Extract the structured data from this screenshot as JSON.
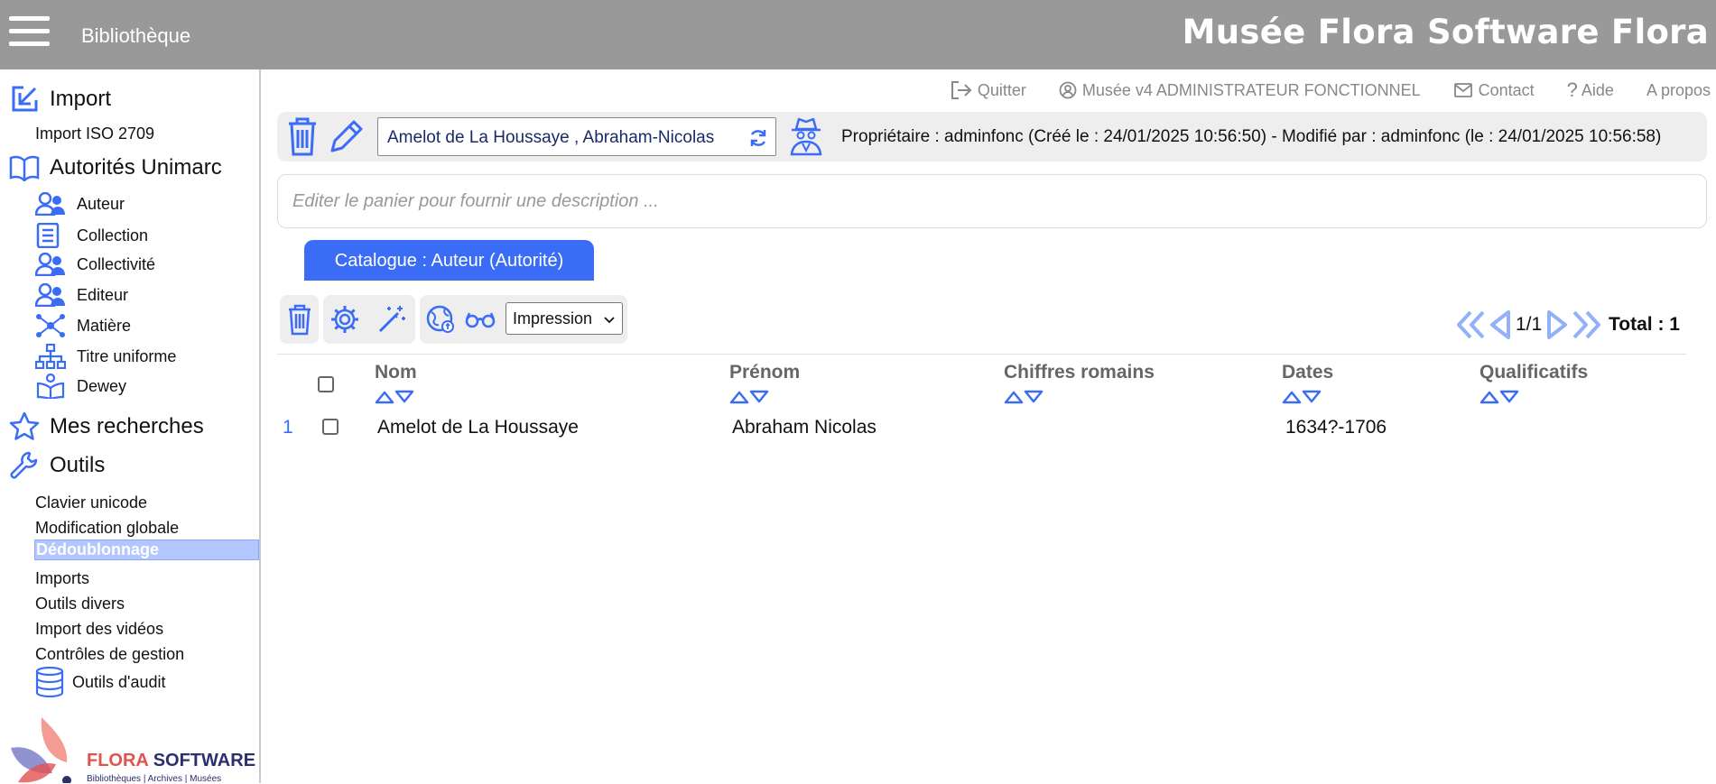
{
  "header": {
    "title": "Bibliothèque",
    "brand": "Musée Flora Software Flora"
  },
  "sidebar": {
    "import": {
      "label": "Import",
      "items": [
        "Import ISO 2709"
      ]
    },
    "autorites": {
      "label": "Autorités Unimarc",
      "items": [
        "Auteur",
        "Collection",
        "Collectivité",
        "Editeur",
        "Matière",
        "Titre uniforme",
        "Dewey"
      ]
    },
    "recherches": {
      "label": "Mes recherches"
    },
    "outils": {
      "label": "Outils",
      "items": [
        "Clavier unicode",
        "Modification globale",
        "Dédoublonnage",
        "Imports",
        "Outils divers",
        "Import des vidéos",
        "Contrôles de gestion",
        "Outils d'audit"
      ]
    },
    "logo": {
      "name_a": "FLORA",
      "name_b": " SOFTWARE",
      "tagline": "Bibliothèques | Archives | Musées"
    }
  },
  "top_links": {
    "quit": "Quitter",
    "user": "Musée v4 ADMINISTRATEUR FONCTIONNEL",
    "contact": "Contact",
    "help": "Aide",
    "about": "A propos"
  },
  "basket": {
    "name": "Amelot de La Houssaye , Abraham-Nicolas",
    "owner_info": "Propriétaire : adminfonc (Créé le : 24/01/2025 10:56:50) - Modifié par : adminfonc (le : 24/01/2025 10:56:58)",
    "description_placeholder": "Editer le panier pour fournir une description ..."
  },
  "tab": {
    "label": "Catalogue : Auteur (Autorité)"
  },
  "toolbar": {
    "print_select": "Impression"
  },
  "pager": {
    "page": "1/1",
    "total": "Total : 1"
  },
  "table": {
    "columns": [
      "Nom",
      "Prénom",
      "Chiffres romains",
      "Dates",
      "Qualificatifs"
    ],
    "rows": [
      {
        "num": "1",
        "nom": "Amelot de La Houssaye",
        "prenom": "Abraham Nicolas",
        "chiffres": "",
        "dates": "1634?-1706",
        "qualificatifs": ""
      }
    ]
  },
  "colors": {
    "accent": "#3b6cf6",
    "topbar": "#999999",
    "active_menu": "#b3c6ff"
  }
}
